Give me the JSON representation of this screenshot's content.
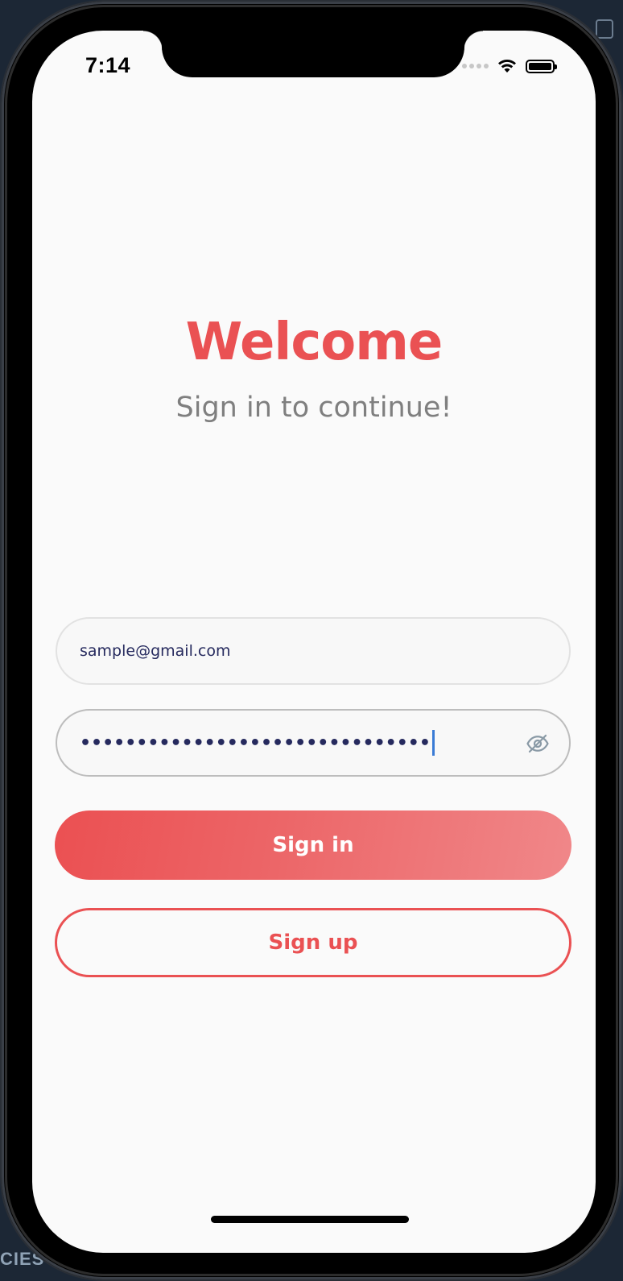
{
  "background": {
    "partial_label": "CIES"
  },
  "status_bar": {
    "time": "7:14"
  },
  "header": {
    "title": "Welcome",
    "subtitle": "Sign in to continue!"
  },
  "form": {
    "email_value": "sample@gmail.com",
    "password_masked": "•••••••••••••••••••••••••••••••",
    "password_toggle_icon": "eye-off-icon"
  },
  "buttons": {
    "sign_in_label": "Sign in",
    "sign_up_label": "Sign up"
  },
  "colors": {
    "accent": "#ea5153",
    "text_dark": "#262a5e",
    "subtitle_gray": "#7f7f7f",
    "caret": "#3a7bd5"
  }
}
